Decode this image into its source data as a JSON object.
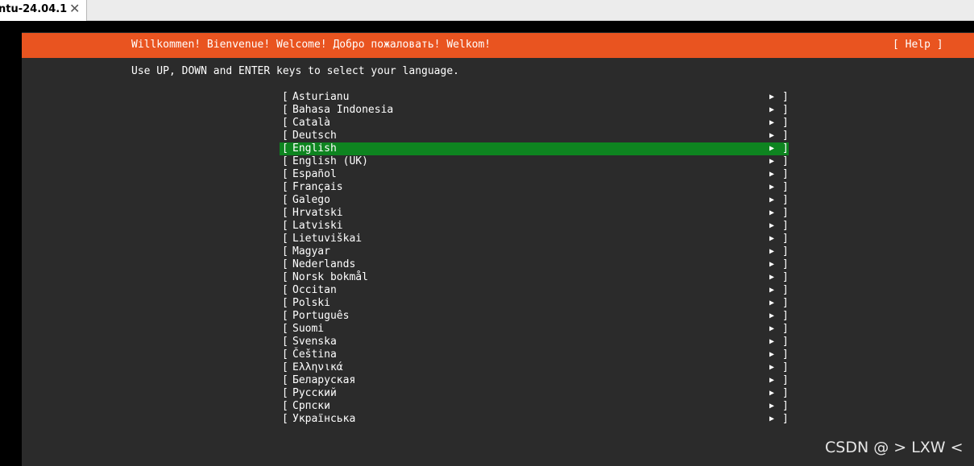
{
  "tab": {
    "title": "ntu-24.04.1",
    "close_glyph": "✕"
  },
  "installer": {
    "header_title": "Willkommen! Bienvenue! Welcome! Добро пожаловать! Welkom!",
    "help_label": "[ Help ]",
    "instructions": "Use UP, DOWN and ENTER keys to select your language.",
    "left_bracket": "[",
    "right_bracket": "]",
    "arrow_glyph": "▶",
    "selected_language": "English",
    "languages": [
      "Asturianu",
      "Bahasa Indonesia",
      "Català",
      "Deutsch",
      "English",
      "English (UK)",
      "Español",
      "Français",
      "Galego",
      "Hrvatski",
      "Latviski",
      "Lietuviškai",
      "Magyar",
      "Nederlands",
      "Norsk bokmål",
      "Occitan",
      "Polski",
      "Português",
      "Suomi",
      "Svenska",
      "Čeština",
      "Ελληνικά",
      "Беларуская",
      "Русский",
      "Српски",
      "Українська"
    ]
  },
  "colors": {
    "header_orange": "#e95420",
    "selection_green": "#0e8420",
    "screen_background": "#2b2b2b"
  },
  "watermark": "CSDN @ > LXW <"
}
